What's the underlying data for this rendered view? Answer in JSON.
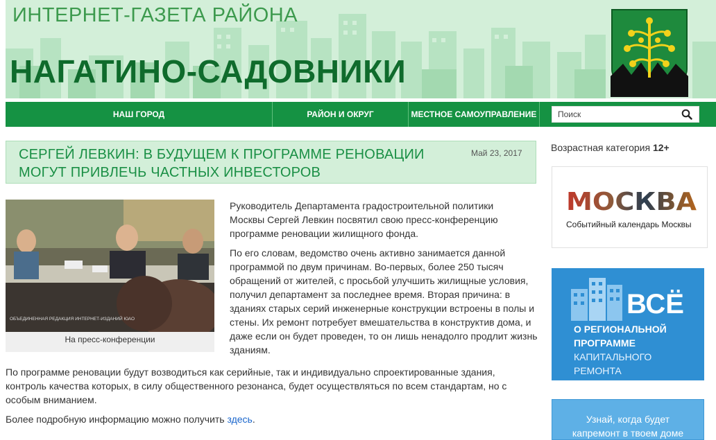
{
  "header": {
    "subtitle": "ИНТЕРНЕТ-ГАЗЕТА РАЙОНА",
    "title": "НАГАТИНО-САДОВНИКИ"
  },
  "nav": {
    "items": [
      {
        "label": "НАШ ГОРОД"
      },
      {
        "label": "РАЙОН И ОКРУГ"
      },
      {
        "label": "МЕСТНОЕ САМОУПРАВЛЕНИЕ"
      }
    ],
    "search_placeholder": "Поиск"
  },
  "article": {
    "title": "СЕРГЕЙ ЛЕВКИН: В БУДУЩЕМ К ПРОГРАММЕ РЕНОВАЦИИ МОГУТ ПРИВЛЕЧЬ ЧАСТНЫХ ИНВЕСТОРОВ",
    "date": "Май 23, 2017",
    "photo_caption": "На пресс-конференции",
    "photo_watermark": "ОБЪЕДИНЕННАЯ РЕДАКЦИЯ ИНТЕРНЕТ-ИЗДАНИЙ ЮАО",
    "paragraphs": [
      "Руководитель Департамента градостроительной политики Москвы Сергей Левкин посвятил свою пресс-конференцию программе реновации жилищного фонда.",
      "По его словам, ведомство очень активно занимается данной программой по двум причинам. Во-первых, более 250 тысяч обращений от жителей, с просьбой улучшить жилищные условия, получил департамент за последнее время. Вторая причина: в зданиях старых серий инженерные конструкции встроены в полы и стены. Их ремонт потребует вмешательства в конструктив дома, и даже если он будет проведен, то он лишь ненадолго продлит жизнь зданиям.",
      "По программе  реновации будут возводиться как серийные, так и индивидуально спроектированные здания, контроль качества которых, в силу общественного резонанса, будет осуществляться по всем стандартам, но с особым вниманием."
    ],
    "more_text": "Более подробную информацию можно получить ",
    "more_link": "здесь",
    "more_end": "."
  },
  "sidebar": {
    "age_label": "Возрастная категория ",
    "age_value": "12+",
    "moscow_banner": {
      "word": "МОСКВА",
      "subtitle": "Событийный календарь Москвы"
    },
    "vse_banner": {
      "big": "ВСЁ",
      "line1": "О РЕГИОНАЛЬНОЙ",
      "line2": "ПРОГРАММЕ",
      "line3": "КАПИТАЛЬНОГО",
      "line4": "РЕМОНТА"
    },
    "kap_banner": {
      "line1": "Узнай, когда будет",
      "line2": "капремонт в твоем доме"
    }
  },
  "colors": {
    "header_bg": "#d3efd9",
    "nav_bg": "#159243",
    "title_green": "#1a8f45",
    "link_blue": "#1a66cc",
    "vse_blue": "#2f8fd3"
  }
}
